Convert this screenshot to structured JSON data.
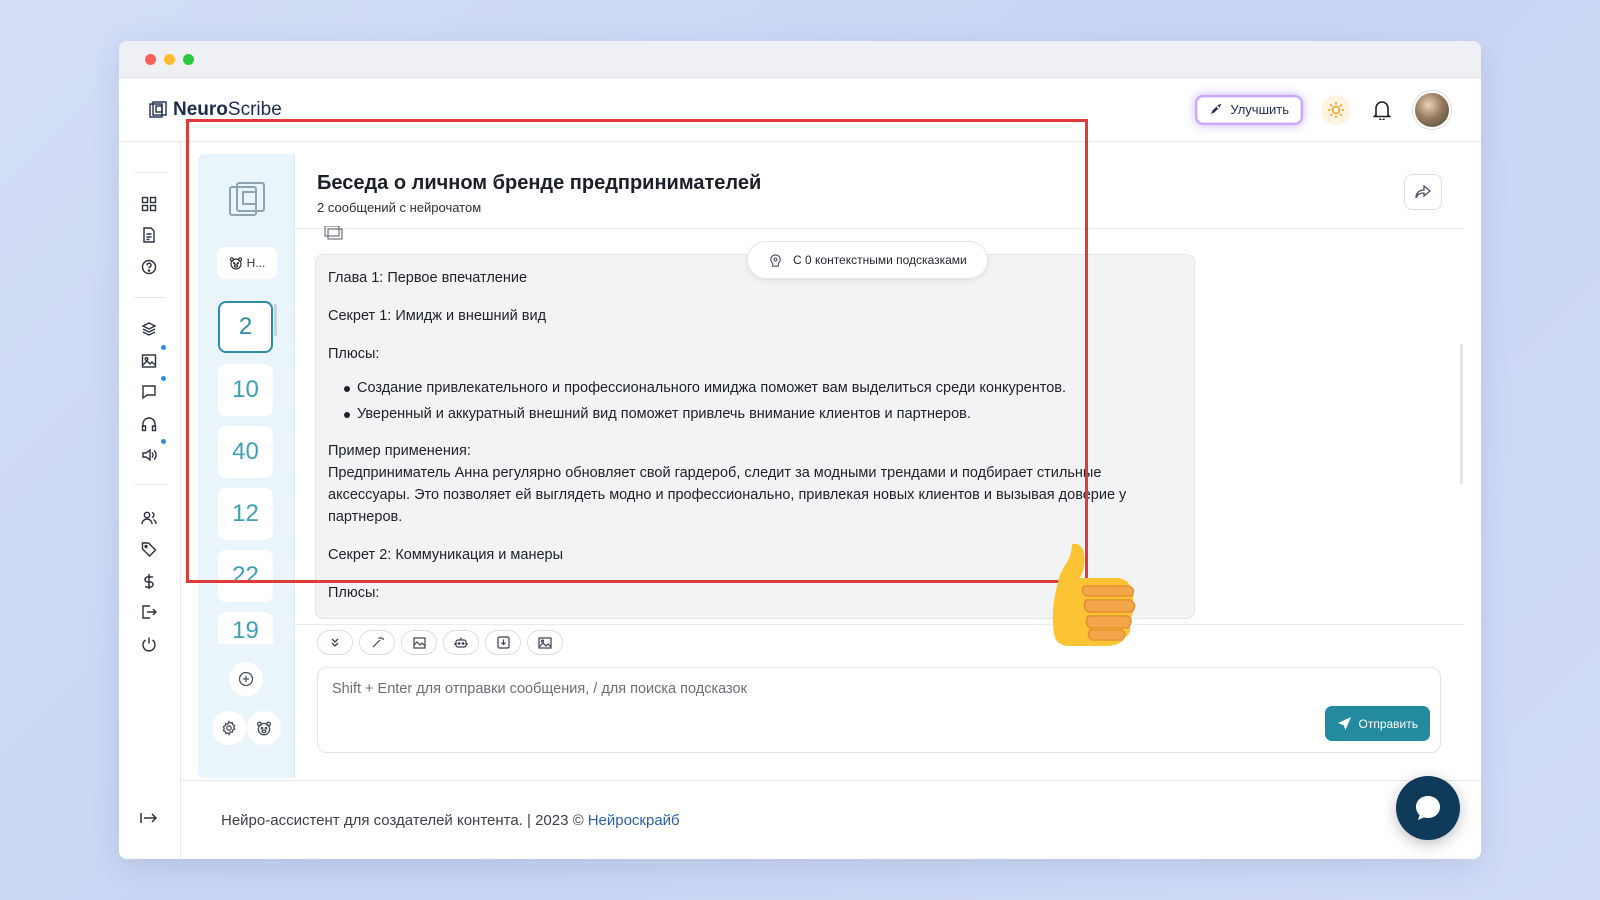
{
  "app": {
    "brand_bold": "Neuro",
    "brand_light": "Scribe",
    "upgrade_label": "Улучшить"
  },
  "icons": {
    "logo": "logo-icon",
    "rocket": "rocket-icon",
    "sun": "sun-icon",
    "bell": "bell-icon",
    "share": "share-icon",
    "send": "send-icon",
    "chat": "chat-bubble-icon"
  },
  "colors": {
    "accent": "#238aa0",
    "highlight": "#e03b3b",
    "brand_link": "#2a5fa8",
    "fab": "#0f3a5a"
  },
  "threads": {
    "chip_label": "Н...",
    "items": [
      "2",
      "10",
      "40",
      "12",
      "22",
      "19"
    ],
    "active_index": 0
  },
  "chat": {
    "title": "Беседа о личном бренде предпринимателей",
    "subtitle": "2 сообщений с нейрочатом",
    "context_pill": "С 0 контекстными подсказками",
    "message": {
      "p1": "Глава 1: Первое впечатление",
      "p2": "Секрет 1: Имидж и внешний вид",
      "p3": "Плюсы:",
      "bullets": [
        "Создание привлекательного и профессионального имиджа поможет вам выделиться среди конкурентов.",
        "Уверенный и аккуратный внешний вид поможет привлечь внимание клиентов и партнеров."
      ],
      "p4_label": "Пример применения:",
      "p4_text": "Предприниматель Анна регулярно обновляет свой гардероб, следит за модными трендами и подбирает стильные аксессуары. Это позволяет ей выглядеть модно и профессионально, привлекая новых клиентов и вызывая доверие у партнеров.",
      "p5": "Секрет 2: Коммуникация и манеры",
      "p6": "Плюсы:"
    },
    "input_placeholder": "Shift + Enter для отправки сообщения, / для поиска подсказок",
    "send_label": "Отправить"
  },
  "footer": {
    "text": "Нейро-ассистент для создателей контента.  | 2023 ©",
    "link": "Нейроскрайб"
  }
}
